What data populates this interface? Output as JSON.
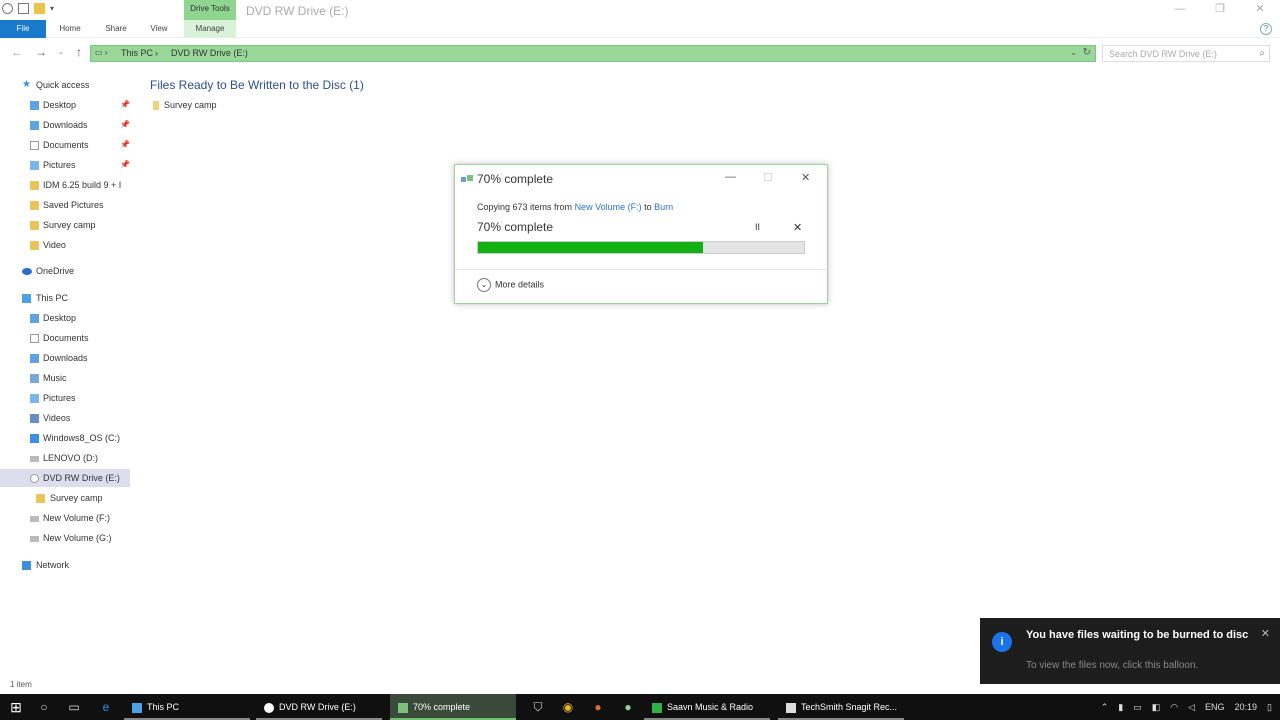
{
  "window": {
    "title": "DVD RW Drive (E:)",
    "context_tab": "Drive Tools",
    "controls": {
      "minimize": "—",
      "maximize": "❐",
      "close": "✕"
    }
  },
  "ribbon": {
    "tabs": [
      "File",
      "Home",
      "Share",
      "View",
      "Manage"
    ],
    "help": "?"
  },
  "address": {
    "crumbs": [
      "This PC",
      "DVD RW Drive (E:)"
    ],
    "search_placeholder": "Search DVD RW Drive (E:)"
  },
  "sidebar": {
    "quick_access": "Quick access",
    "quick_items": [
      {
        "label": "Desktop",
        "pinned": true
      },
      {
        "label": "Downloads",
        "pinned": true
      },
      {
        "label": "Documents",
        "pinned": true
      },
      {
        "label": "Pictures",
        "pinned": true
      },
      {
        "label": "IDM 6.25 build 9 + I",
        "pinned": false
      },
      {
        "label": "Saved Pictures",
        "pinned": false
      },
      {
        "label": "Survey camp",
        "pinned": false
      },
      {
        "label": "Video",
        "pinned": false
      }
    ],
    "onedrive": "OneDrive",
    "this_pc": "This PC",
    "pc_items": [
      "Desktop",
      "Documents",
      "Downloads",
      "Music",
      "Pictures",
      "Videos",
      "Windows8_OS (C:)",
      "LENOVO (D:)",
      "DVD RW Drive (E:)",
      "Survey camp",
      "New Volume (F:)",
      "New Volume (G:)"
    ],
    "network": "Network",
    "pin_glyph": "📌"
  },
  "content": {
    "group_header": "Files Ready to Be Written to the Disc (1)",
    "files": [
      "Survey camp"
    ]
  },
  "dialog": {
    "title": "70% complete",
    "copying_prefix": "Copying 673 items from",
    "source": "New Volume (F:)",
    "to": "to",
    "destination": "Burn",
    "progress_text": "70% complete",
    "progress": 0.69,
    "more_details": "More details",
    "pause": "II",
    "cancel": "✕",
    "chevron": "⌄"
  },
  "status": {
    "item_count": "1 item"
  },
  "notification": {
    "title": "You have files waiting to be burned to disc",
    "body": "To view the files now, click this balloon.",
    "icon": "i",
    "close": "✕"
  },
  "taskbar": {
    "apps": [
      {
        "label": "This PC",
        "state": "open"
      },
      {
        "label": "DVD RW Drive (E:)",
        "state": "open"
      },
      {
        "label": "70% complete",
        "state": "active"
      },
      {
        "label": "Saavn Music & Radio",
        "state": "open"
      },
      {
        "label": "TechSmith Snagit Rec...",
        "state": "open"
      }
    ],
    "language": "ENG",
    "time": "20:19"
  },
  "colors": {
    "accent": "#1979ca",
    "progress_green": "#12b012",
    "address_bar_highlight": "#9ad89a",
    "balloon_bg": "#1d1d1d"
  }
}
